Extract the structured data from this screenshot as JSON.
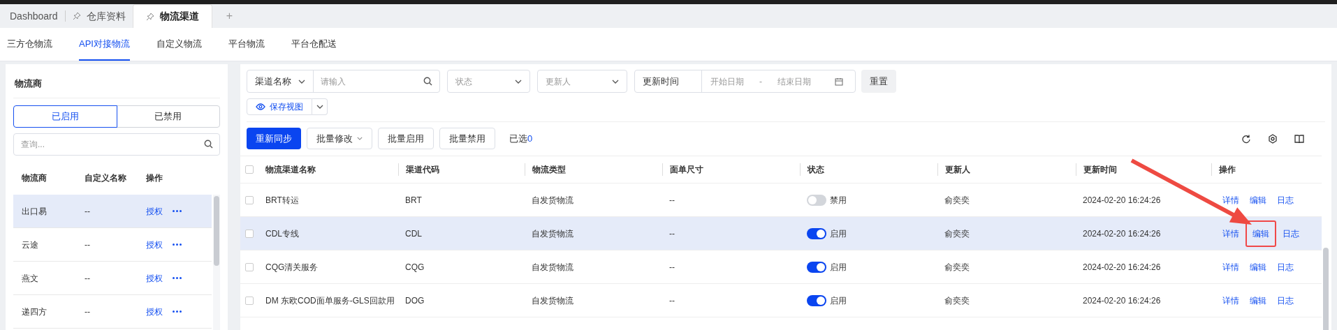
{
  "page_tabs": [
    {
      "label": "Dashboard",
      "pinned": false,
      "selected": false
    },
    {
      "label": "仓库资料",
      "pinned": true,
      "selected": false
    },
    {
      "label": "物流渠道",
      "pinned": true,
      "selected": true
    }
  ],
  "add_tab": "+",
  "sub_tabs": [
    {
      "label": "三方仓物流",
      "selected": false
    },
    {
      "label": "API对接物流",
      "selected": true
    },
    {
      "label": "自定义物流",
      "selected": false
    },
    {
      "label": "平台物流",
      "selected": false
    },
    {
      "label": "平台仓配送",
      "selected": false
    }
  ],
  "carrier_panel": {
    "title": "物流商",
    "segments": [
      {
        "label": "已启用",
        "selected": true
      },
      {
        "label": "已禁用",
        "selected": false
      }
    ],
    "search": {
      "placeholder": "查询..."
    },
    "columns": [
      "物流商",
      "自定义名称",
      "操作"
    ],
    "rows": [
      {
        "name": "出口易",
        "custom_name": "--",
        "action": "授权",
        "selected": true
      },
      {
        "name": "云途",
        "custom_name": "--",
        "action": "授权",
        "selected": false
      },
      {
        "name": "燕文",
        "custom_name": "--",
        "action": "授权",
        "selected": false
      },
      {
        "name": "递四方",
        "custom_name": "--",
        "action": "授权",
        "selected": false
      }
    ]
  },
  "filters": {
    "field_select": "渠道名称",
    "keyword": {
      "placeholder": "请输入"
    },
    "status": {
      "placeholder": "状态"
    },
    "updater": {
      "placeholder": "更新人"
    },
    "time_select": "更新时间",
    "start_date": {
      "placeholder": "开始日期"
    },
    "date_separator": "-",
    "end_date": {
      "placeholder": "结束日期"
    },
    "reset": "重置",
    "save_view": "保存视图"
  },
  "toolbar": {
    "sync": "重新同步",
    "batch_edit": "批量修改",
    "batch_enable": "批量启用",
    "batch_disable": "批量禁用",
    "selected_label": "已选",
    "selected_count": "0"
  },
  "table": {
    "all_checked": false,
    "columns": [
      "物流渠道名称",
      "渠道代码",
      "物流类型",
      "面单尺寸",
      "状态",
      "更新人",
      "更新时间",
      "操作"
    ],
    "rows": [
      {
        "name": "BRT转运",
        "code": "BRT",
        "type": "自发货物流",
        "size": "--",
        "enabled": false,
        "status": "禁用",
        "updater": "俞奕奕",
        "time": "2024-02-20 16:24:26",
        "actions": [
          "详情",
          "编辑",
          "日志"
        ],
        "selected": false,
        "checked": false,
        "highlighted_action": false
      },
      {
        "name": "CDL专线",
        "code": "CDL",
        "type": "自发货物流",
        "size": "--",
        "enabled": true,
        "status": "启用",
        "updater": "俞奕奕",
        "time": "2024-02-20 16:24:26",
        "actions": [
          "详情",
          "编辑",
          "日志"
        ],
        "selected": true,
        "checked": false,
        "highlighted_action": true
      },
      {
        "name": "CQG清关服务",
        "code": "CQG",
        "type": "自发货物流",
        "size": "--",
        "enabled": true,
        "status": "启用",
        "updater": "俞奕奕",
        "time": "2024-02-20 16:24:26",
        "actions": [
          "详情",
          "编辑",
          "日志"
        ],
        "selected": false,
        "checked": false,
        "highlighted_action": false
      },
      {
        "name": "DM 东欧COD面单服务-GLS回款用",
        "code": "DOG",
        "type": "自发货物流",
        "size": "--",
        "enabled": true,
        "status": "启用",
        "updater": "俞奕奕",
        "time": "2024-02-20 16:24:26",
        "actions": [
          "详情",
          "编辑",
          "日志"
        ],
        "selected": false,
        "checked": false,
        "highlighted_action": false
      }
    ]
  }
}
